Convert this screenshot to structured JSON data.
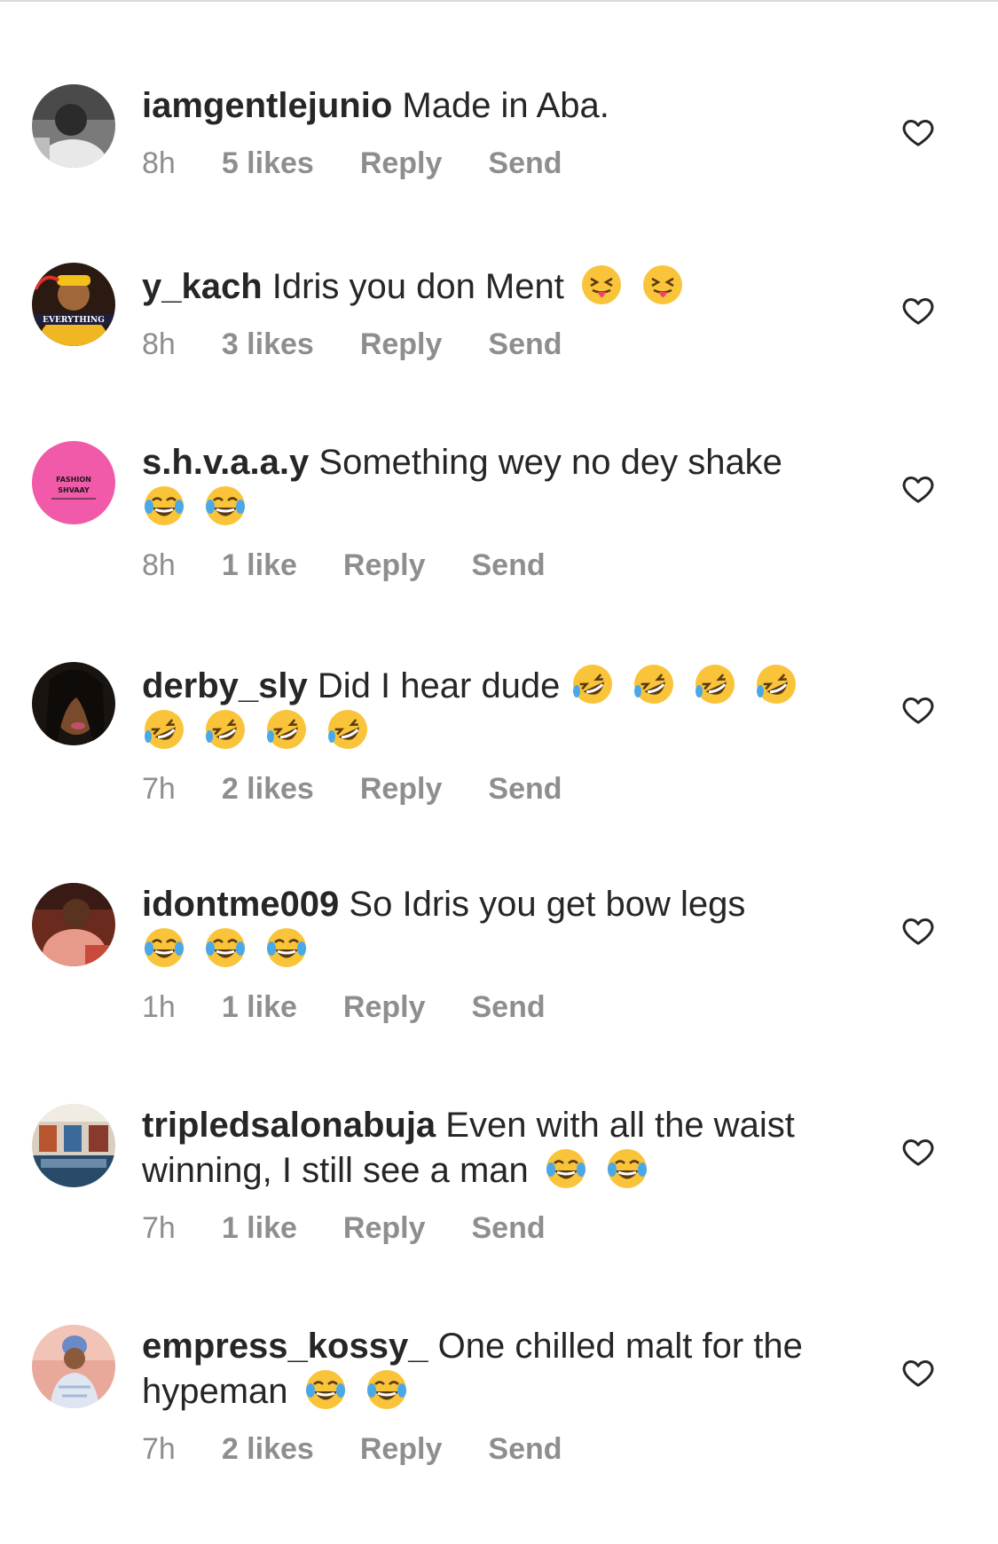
{
  "header": {
    "fragment_text": "· · ·"
  },
  "comments": [
    {
      "username": "iamgentlejunio",
      "text": "Made in Aba.",
      "time": "8h",
      "likes": "5 likes",
      "reply": "Reply",
      "send": "Send",
      "emojis": []
    },
    {
      "username": "y_kach",
      "text": "Idris you don Ment",
      "time": "8h",
      "likes": "3 likes",
      "reply": "Reply",
      "send": "Send",
      "emojis": [
        "squinting-tongue-emoji",
        "squinting-tongue-emoji"
      ]
    },
    {
      "username": "s.h.v.a.a.y",
      "text": "Something wey no dey shake",
      "time": "8h",
      "likes": "1 like",
      "reply": "Reply",
      "send": "Send",
      "emojis": [
        "tears-of-joy-emoji",
        "tears-of-joy-emoji"
      ]
    },
    {
      "username": "derby_sly",
      "text": "Did I hear dude",
      "time": "7h",
      "likes": "2 likes",
      "reply": "Reply",
      "send": "Send",
      "emojis": [
        "rolling-laughing-emoji",
        "rolling-laughing-emoji",
        "rolling-laughing-emoji",
        "rolling-laughing-emoji",
        "rolling-laughing-emoji",
        "rolling-laughing-emoji",
        "rolling-laughing-emoji",
        "rolling-laughing-emoji"
      ]
    },
    {
      "username": "idontme009",
      "text": "So Idris you get bow legs",
      "time": "1h",
      "likes": "1 like",
      "reply": "Reply",
      "send": "Send",
      "emojis": [
        "tears-of-joy-emoji",
        "tears-of-joy-emoji",
        "tears-of-joy-emoji"
      ]
    },
    {
      "username": "tripledsalonabuja",
      "text": "Even with all the waist winning, I still see a man",
      "time": "7h",
      "likes": "1 like",
      "reply": "Reply",
      "send": "Send",
      "emojis": [
        "tears-of-joy-emoji",
        "tears-of-joy-emoji"
      ]
    },
    {
      "username": "empress_kossy_",
      "text": "One chilled malt for the hypeman",
      "time": "7h",
      "likes": "2 likes",
      "reply": "Reply",
      "send": "Send",
      "emojis": [
        "tears-of-joy-emoji",
        "tears-of-joy-emoji"
      ]
    }
  ],
  "avatars": {
    "s.h.v.a.a.y": {
      "line1": "FASHION",
      "line2": "SHVAAY"
    },
    "y_kach": {
      "label": "EVERYTHING"
    }
  },
  "colors": {
    "text": "#262626",
    "secondary": "#8e8e8e",
    "heart_outline": "#262626",
    "shvaay_avatar_bg": "#f05aa8",
    "emoji_yellow": "#f9c43a"
  }
}
